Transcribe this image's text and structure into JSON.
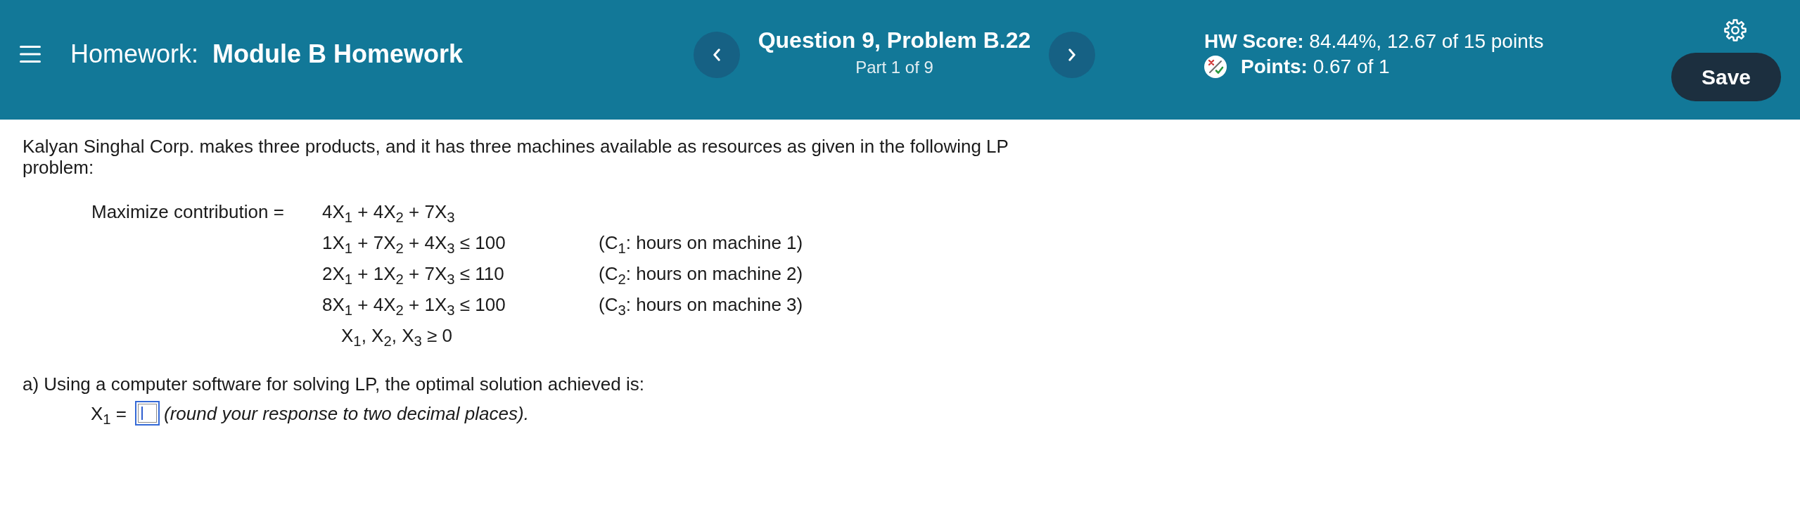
{
  "header": {
    "title": "Homework:  **Module B Homework**",
    "question": {
      "title": "Question 9, Problem B.22",
      "part": "Part 1 of 9"
    },
    "score": "**HW Score:** 84.44%, 12.67 of 15 points",
    "points": "**Points:** 0.67 of 1",
    "save_button": "Save"
  },
  "problem": {
    "intro": "Kalyan Singhal Corp. makes three products, and it has three machines available as resources as given in the following LP problem:",
    "objective": {
      "label": "Maximize contribution =",
      "expression": "4X$_{1}$ + 4X$_{2}$ + 7X$_{3}$"
    },
    "constraints": [
      {
        "expression": "1X$_{1}$ + 7X$_{2}$ + 4X$_{3}$ ≤ 100",
        "note": "(C$_{1}$: hours on machine 1)"
      },
      {
        "expression": "2X$_{1}$ + 1X$_{2}$ + 7X$_{3}$ ≤ 110",
        "note": "(C$_{2}$: hours on machine 2)"
      },
      {
        "expression": "8X$_{1}$ + 4X$_{2}$ + 1X$_{3}$ ≤ 100",
        "note": "(C$_{3}$: hours on machine 3)"
      }
    ],
    "nonnegativity": "X$_{1}$, X$_{2}$, X$_{3}$ ≥ 0"
  },
  "part_a": {
    "prompt": "a) Using a computer software for solving LP, the optimal solution achieved is:",
    "answers": [
      {
        "variable": "X$_{1}$ =",
        "focused": true,
        "hint": "(round your response to two decimal places)."
      }
    ]
  }
}
